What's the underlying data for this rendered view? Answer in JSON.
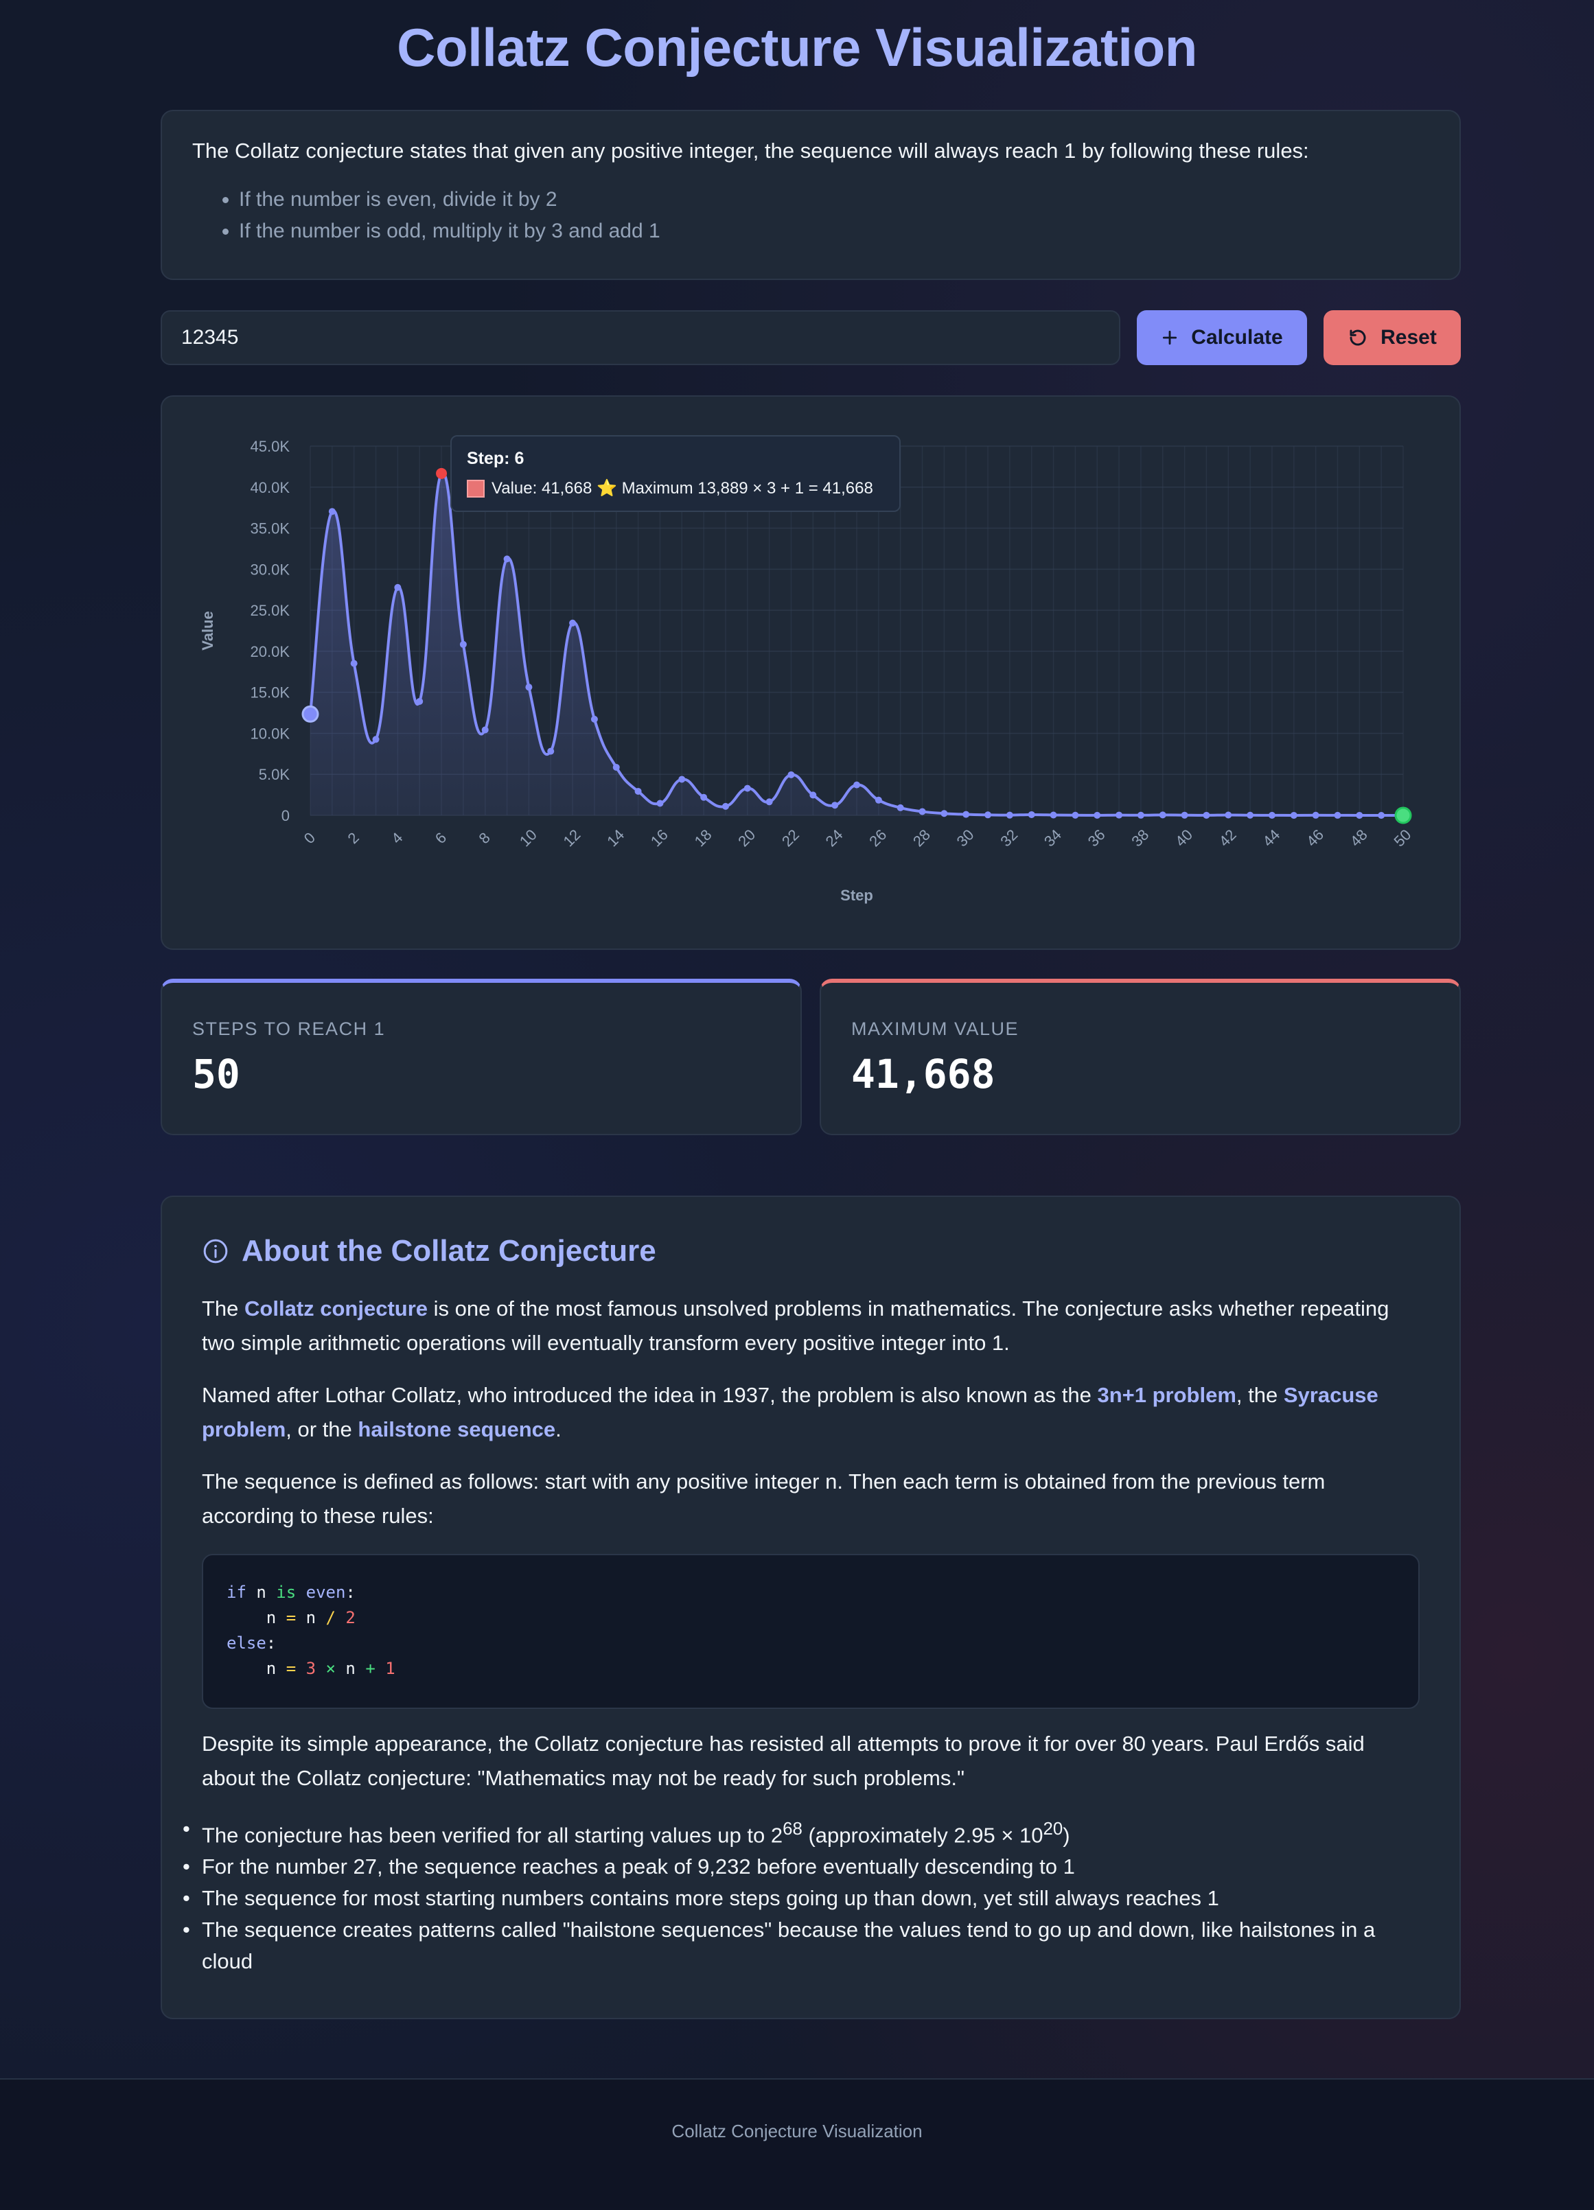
{
  "header": {
    "title": "Collatz Conjecture Visualization"
  },
  "intro": {
    "text": "The Collatz conjecture states that given any positive integer, the sequence will always reach 1 by following these rules:",
    "rules": [
      "If the number is even, divide it by 2",
      "If the number is odd, multiply it by 3 and add 1"
    ]
  },
  "controls": {
    "input_value": "12345",
    "calculate_label": "Calculate",
    "reset_label": "Reset"
  },
  "chart_data": {
    "type": "line",
    "xlabel": "Step",
    "ylabel": "Value",
    "ylim": [
      0,
      45000
    ],
    "xlim": [
      0,
      50
    ],
    "y_ticks": [
      "0",
      "5.0K",
      "10.0K",
      "15.0K",
      "20.0K",
      "25.0K",
      "30.0K",
      "35.0K",
      "40.0K",
      "45.0K"
    ],
    "x_ticks": [
      "0",
      "2",
      "4",
      "6",
      "8",
      "10",
      "12",
      "14",
      "16",
      "18",
      "20",
      "22",
      "24",
      "26",
      "28",
      "30",
      "32",
      "34",
      "36",
      "38",
      "40",
      "42",
      "44",
      "46",
      "48",
      "50"
    ],
    "grid": true,
    "series": [
      {
        "values": [
          12345,
          37036,
          18518,
          9259,
          27778,
          13889,
          41668,
          20834,
          10417,
          31252,
          15626,
          7813,
          23440,
          11720,
          5860,
          2930,
          1465,
          4396,
          2198,
          1099,
          3298,
          1649,
          4948,
          2474,
          1237,
          3712,
          1856,
          928,
          464,
          232,
          116,
          58,
          29,
          88,
          44,
          22,
          11,
          34,
          17,
          52,
          26,
          13,
          40,
          20,
          10,
          5,
          16,
          8,
          4,
          2,
          1
        ]
      }
    ],
    "highlight": {
      "step": 6,
      "value": 41668
    },
    "start_point": {
      "step": 0,
      "value": 12345
    },
    "end_point": {
      "step": 50,
      "value": 1
    },
    "colors": {
      "line": "#818cf8",
      "max": "#ef4444",
      "end": "#4ade80"
    },
    "tooltip": {
      "title": "Step: 6",
      "text": "Value: 41,668 ⭐ Maximum 13,889 × 3 + 1 = 41,668"
    }
  },
  "stats": {
    "steps_label": "STEPS TO REACH 1",
    "steps_value": "50",
    "max_label": "MAXIMUM VALUE",
    "max_value": "41,668"
  },
  "about": {
    "title": "About the Collatz Conjecture",
    "p1_pre": "The ",
    "p1_link": "Collatz conjecture",
    "p1_post": " is one of the most famous unsolved problems in mathematics. The conjecture asks whether repeating two simple arithmetic operations will eventually transform every positive integer into 1.",
    "p2_pre": "Named after Lothar Collatz, who introduced the idea in 1937, the problem is also known as the ",
    "p2_link1": "3n+1 problem",
    "p2_mid1": ", the ",
    "p2_link2": "Syracuse problem",
    "p2_mid2": ", or the ",
    "p2_link3": "hailstone sequence",
    "p2_end": ".",
    "p3": "The sequence is defined as follows: start with any positive integer n. Then each term is obtained from the previous term according to these rules:",
    "p4": "Despite its simple appearance, the Collatz conjecture has resisted all attempts to prove it for over 80 years. Paul Erdős said about the Collatz conjecture: \"Mathematics may not be ready for such problems.\"",
    "fact1_pre": "The conjecture has been verified for all starting values up to 2",
    "fact1_exp1": "68",
    "fact1_mid": " (approximately 2.95 × 10",
    "fact1_exp2": "20",
    "fact1_end": ")",
    "fact2": "For the number 27, the sequence reaches a peak of 9,232 before eventually descending to 1",
    "fact3": "The sequence for most starting numbers contains more steps going up than down, yet still always reaches 1",
    "fact4": "The sequence creates patterns called \"hailstone sequences\" because the values tend to go up and down, like hailstones in a cloud"
  },
  "code": {
    "l1_if": "if",
    "l1_n": "n",
    "l1_is": "is",
    "l1_even": "even",
    "l1_colon": ":",
    "l2_n": "n",
    "l2_eq": "=",
    "l2_n2": "n",
    "l2_div": "/",
    "l2_2": "2",
    "l3_else": "else",
    "l3_colon": ":",
    "l4_n": "n",
    "l4_eq": "=",
    "l4_3": "3",
    "l4_x": "×",
    "l4_n2": "n",
    "l4_plus": "+",
    "l4_1": "1"
  },
  "footer": {
    "text": "Collatz Conjecture Visualization"
  }
}
